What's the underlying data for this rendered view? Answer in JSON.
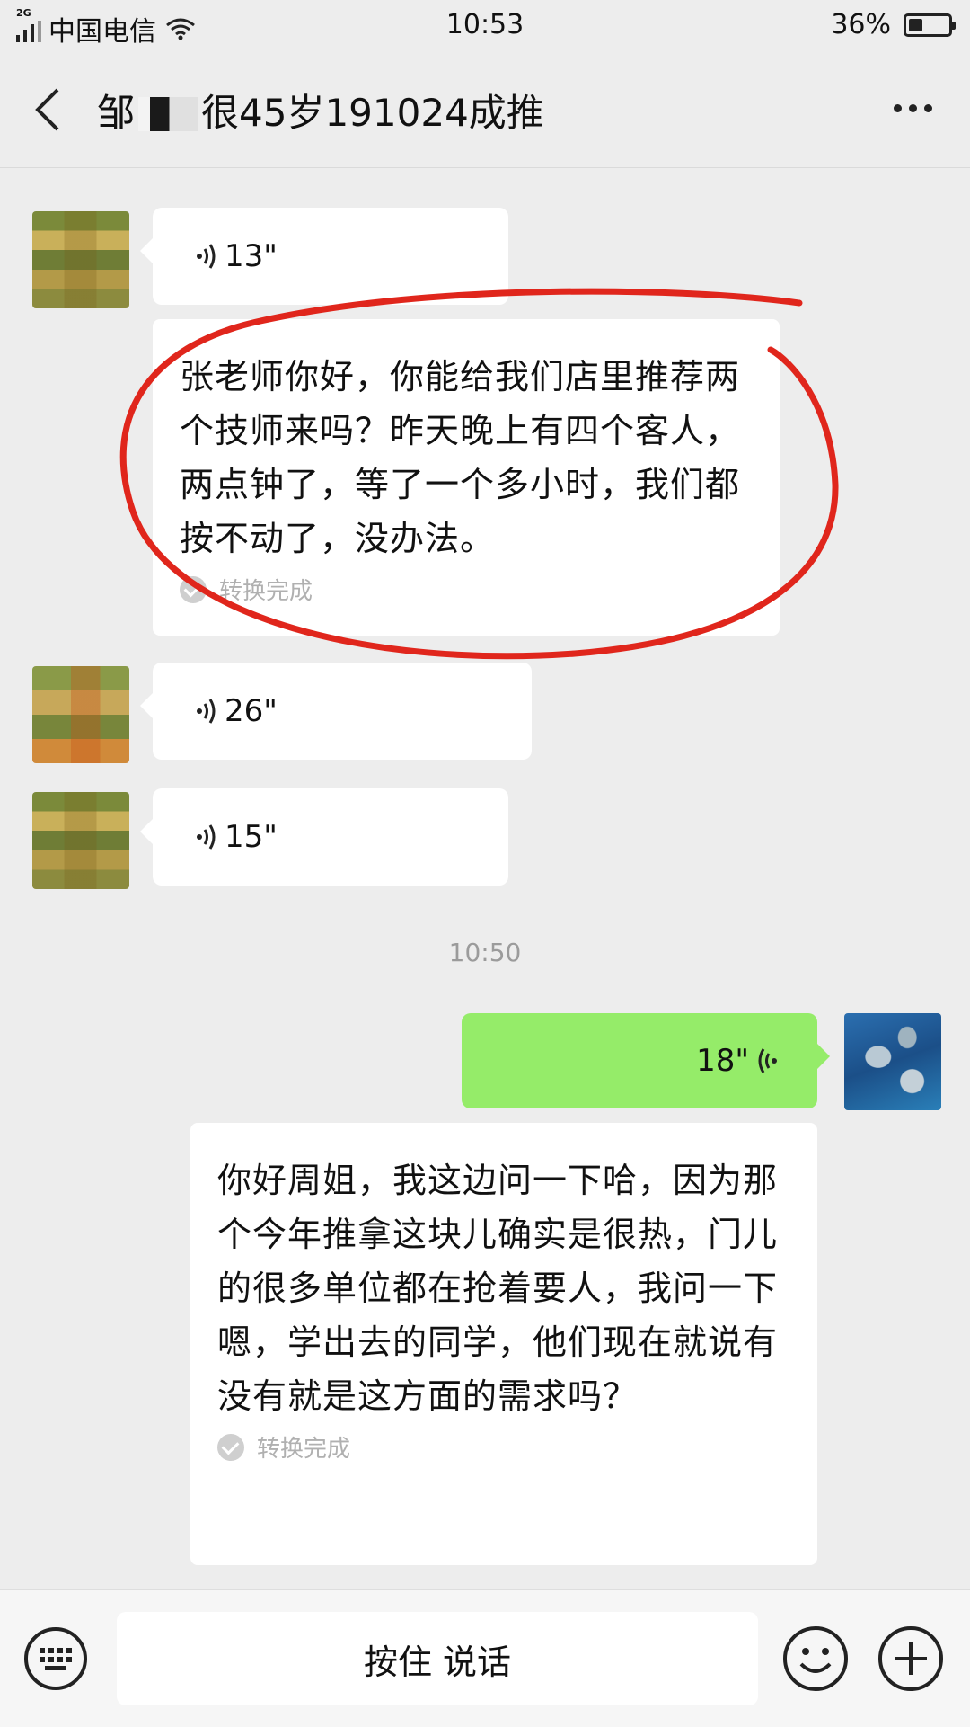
{
  "status_bar": {
    "network": "2G",
    "carrier": "中国电信",
    "time": "10:53",
    "battery_percent": "36%",
    "battery_level": 0.36
  },
  "header": {
    "title_prefix": "邹",
    "title_suffix": "很45岁191024成推"
  },
  "messages": [
    {
      "type": "voice",
      "direction": "incoming",
      "duration": "13\""
    },
    {
      "type": "transcript",
      "text": "张老师你好，你能给我们店里推荐两个技师来吗？昨天晚上有四个客人，两点钟了，等了一个多小时，我们都按不动了，没办法。",
      "status": "转换完成"
    },
    {
      "type": "voice",
      "direction": "incoming",
      "duration": "26\""
    },
    {
      "type": "voice",
      "direction": "incoming",
      "duration": "15\""
    },
    {
      "type": "timestamp",
      "text": "10:50"
    },
    {
      "type": "voice",
      "direction": "outgoing",
      "duration": "18\""
    },
    {
      "type": "transcript",
      "text": "你好周姐，我这边问一下哈，因为那个今年推拿这块儿确实是很热，门儿的很多单位都在抢着要人，我问一下嗯，学出去的同学，他们现在就说有没有就是这方面的需求吗？",
      "status": "转换完成"
    }
  ],
  "bottom_bar": {
    "talk_label": "按住 说话"
  },
  "colors": {
    "outgoing_bubble": "#95ec69",
    "annotation_circle": "#e0261c"
  }
}
